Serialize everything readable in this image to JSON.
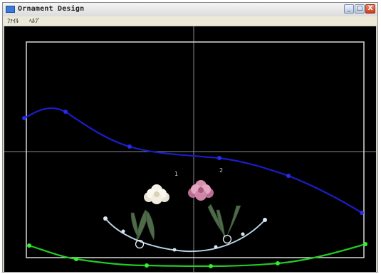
{
  "window": {
    "title": "Ornament Design",
    "minimize_glyph": "_",
    "maximize_glyph": "□",
    "close_glyph": "X"
  },
  "menu": {
    "file": "ﾌｧｲﾙ",
    "help": "ﾍﾙﾌﾟ"
  },
  "canvas": {
    "labels": [
      "1",
      "2"
    ],
    "colors": {
      "background": "#000000",
      "frame": "#d8d8d8",
      "crosshair": "#8a8a8a",
      "blue_curve": "#1c1ccc",
      "green_curve": "#22cc22",
      "light_curve": "#b8d4e4",
      "flower_1": "#f2efe2",
      "flower_2": "#d890b0",
      "leaves": "#4e6a48"
    },
    "icons": [
      "flower-1-icon",
      "flower-2-icon"
    ]
  }
}
